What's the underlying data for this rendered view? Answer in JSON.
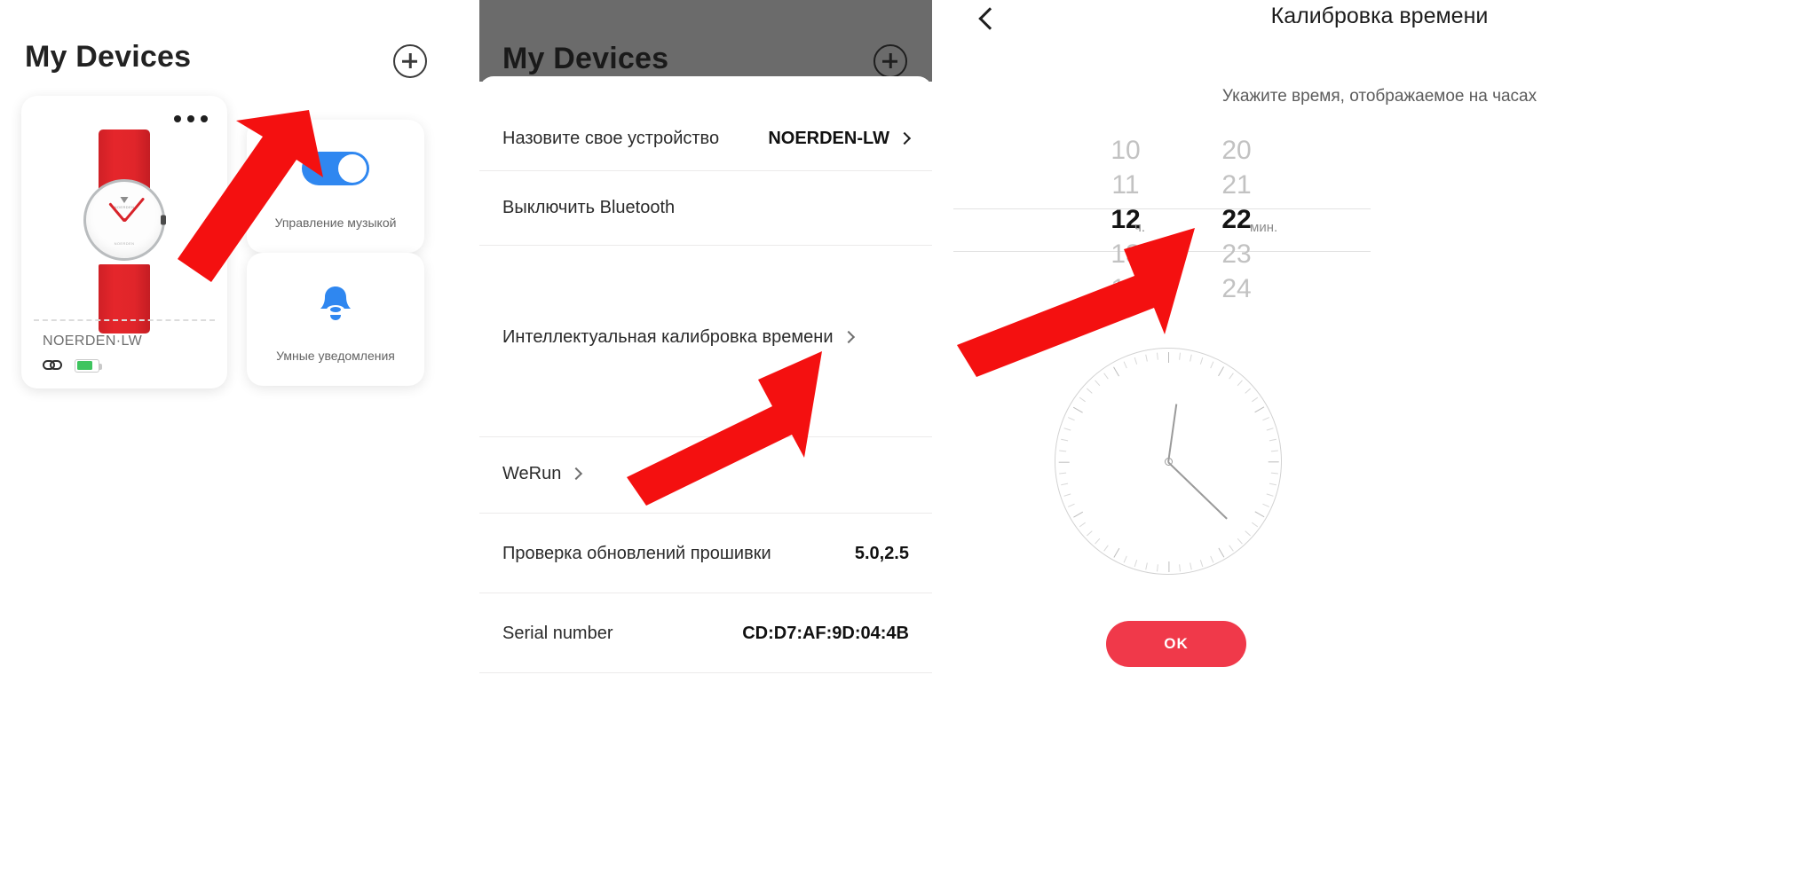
{
  "panel1": {
    "title": "My Devices",
    "add_icon": "plus-circle-icon",
    "device_card": {
      "more_icon": "more-options-icon",
      "product_image": "red-strap-analog-watch",
      "dial_brand_top": "NOERDEN",
      "dial_brand_bottom": "NOERDEN",
      "name": "NOERDEN·LW",
      "link_icon": "link-icon",
      "battery_icon": "battery-icon",
      "battery_level_percent": 66,
      "battery_color": "#3fc45f"
    },
    "tiles": [
      {
        "label": "Управление музыкой",
        "control": "toggle-switch",
        "state": "on",
        "accent": "#2f87f0"
      },
      {
        "label": "Умные уведомления",
        "control": "bell-icon",
        "accent": "#2f87f0"
      }
    ]
  },
  "panel2": {
    "header_title": "My Devices",
    "header_bg": "#6b6b6b",
    "add_icon": "plus-circle-icon",
    "rows": [
      {
        "label": "Назовите свое устройство",
        "value": "NOERDEN-LW",
        "chevron": true
      },
      {
        "label": "Выключить Bluetooth",
        "value": "",
        "chevron": false
      },
      {
        "label": "Интеллектуальная калибровка времени",
        "value": "",
        "chevron": true
      },
      {
        "label": "WeRun",
        "value": "",
        "chevron": true
      },
      {
        "label": "Проверка обновлений прошивки",
        "value": "5.0,2.5",
        "chevron": false
      },
      {
        "label": "Serial number",
        "value": "CD:D7:AF:9D:04:4B",
        "chevron": false
      }
    ]
  },
  "panel3": {
    "back_icon": "chevron-left-icon",
    "title": "Калибровка времени",
    "hint": "Укажите время, отображаемое на часах",
    "hours": {
      "items": [
        "10",
        "11",
        "12",
        "13",
        "14"
      ],
      "selected_index": 2,
      "unit": "ч."
    },
    "minutes": {
      "items": [
        "20",
        "21",
        "22",
        "23",
        "24"
      ],
      "selected_index": 2,
      "unit": "мин."
    },
    "clock": {
      "icon": "analog-clock-face",
      "hour_angle_deg": -82,
      "minute_angle_deg": 44
    },
    "ok_label": "OK",
    "ok_color": "#f0394a"
  },
  "annotations": {
    "arrow_color": "#f41010",
    "arrows": [
      {
        "name": "arrow-to-more-options",
        "points_at": "more-options-icon"
      },
      {
        "name": "arrow-to-time-calibration",
        "points_at": "Интеллектуальная калибровка времени"
      },
      {
        "name": "arrow-to-selected-time",
        "points_at": "12:22"
      }
    ]
  }
}
